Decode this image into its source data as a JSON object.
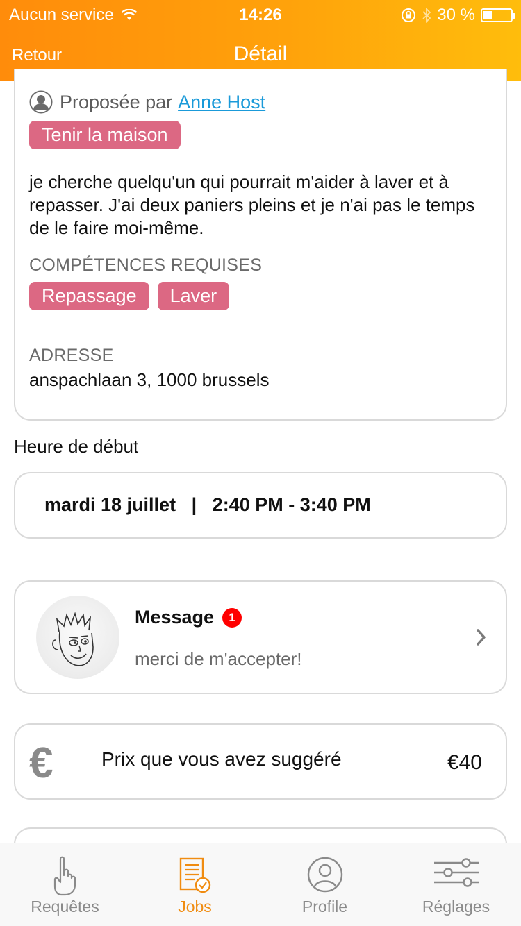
{
  "status_bar": {
    "carrier": "Aucun service",
    "time": "14:26",
    "battery": "30 %",
    "battery_level": 0.3
  },
  "nav": {
    "back": "Retour",
    "title": "Détail"
  },
  "job": {
    "proposed_by_prefix": "Proposée par",
    "proposer_name": "Anne Host",
    "category": "Tenir la maison",
    "description": "je cherche quelqu'un qui pourrait m'aider à laver et à repasser. J'ai deux paniers pleins et je n'ai pas le temps de le faire moi-même.",
    "skills_label": "COMPÉTENCES REQUISES",
    "skills": [
      "Repassage",
      "Laver"
    ],
    "address_label": "ADRESSE",
    "address": "anspachlaan  3, 1000 brussels"
  },
  "schedule": {
    "label": "Heure de début",
    "date": "mardi 18 juillet",
    "separator": "|",
    "time_range": "2:40 PM - 3:40 PM"
  },
  "message": {
    "title": "Message",
    "unread_count": "1",
    "preview": "merci de m'accepter!"
  },
  "price": {
    "currency_symbol": "€",
    "label": "Prix que vous avez suggéré",
    "value": "€40"
  },
  "tabs": [
    {
      "label": "Requêtes",
      "icon": "hand-pointing-icon",
      "active": false
    },
    {
      "label": "Jobs",
      "icon": "document-check-icon",
      "active": true
    },
    {
      "label": "Profile",
      "icon": "profile-circle-icon",
      "active": false
    },
    {
      "label": "Réglages",
      "icon": "sliders-icon",
      "active": false
    }
  ],
  "colors": {
    "header_start": "#ff8c0b",
    "header_end": "#ffbd0c",
    "tag": "#dc6883",
    "link": "#1a9ad9",
    "active_tab": "#f08c11",
    "badge": "#ff0000"
  }
}
